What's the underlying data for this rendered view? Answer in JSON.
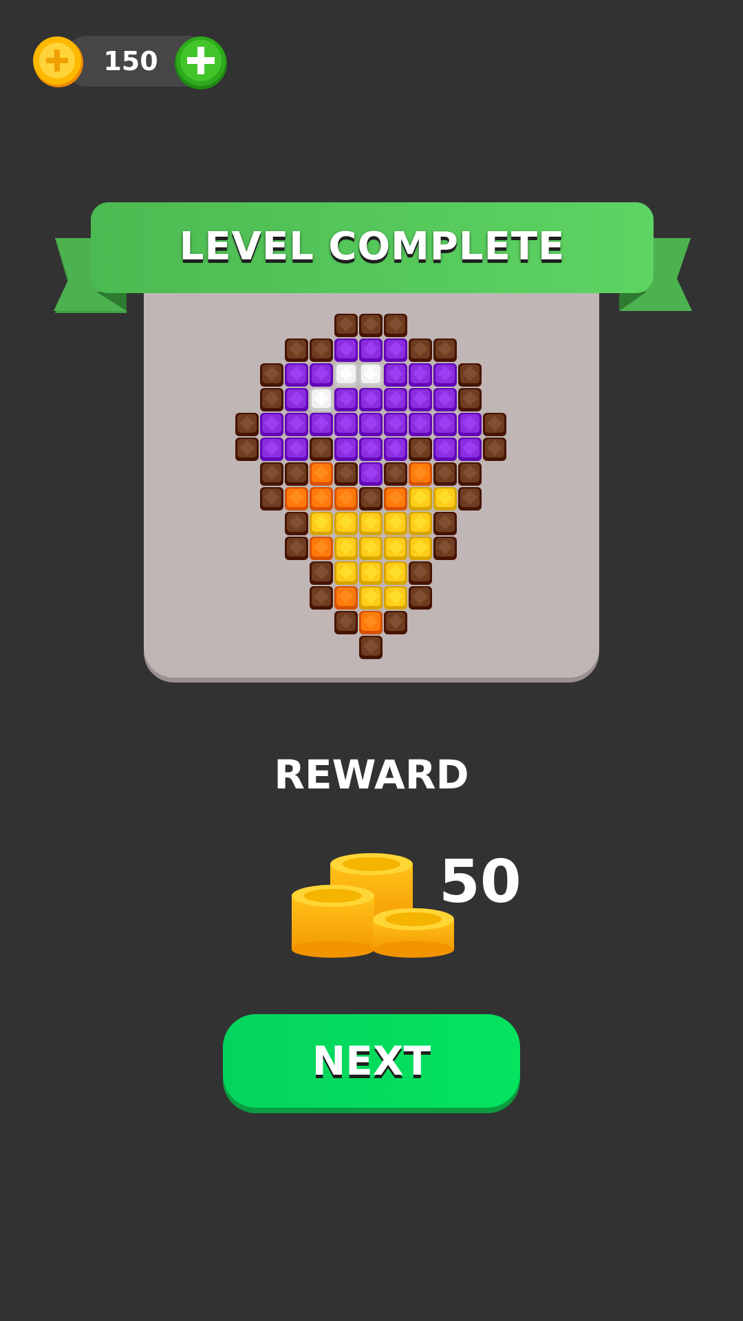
{
  "hud": {
    "coins": "150",
    "coin_icon": "coin-icon",
    "add_icon": "plus-icon"
  },
  "banner": {
    "title": "LEVEL COMPLETE"
  },
  "puzzle": {
    "colors": {
      "B": "#6e3c20",
      "P": "#8a2ee0",
      "W": "#f2f2f2",
      "O": "#ff7a0a",
      "Y": "#ffcc1a"
    },
    "rows": [
      "....BBB....",
      "..BBPPPBB..",
      ".BPPWWPPPB.",
      ".BPWPPPPPB.",
      "BPPPPPPPPPB",
      "BPPBPPPBPPB",
      ".BBOBPBOBB.",
      ".BOOOBOYYB.",
      "..BYYYYYB..",
      "..BOYYYYB..",
      "...BYYYB...",
      "...BOYYB...",
      "....BOB....",
      ".....B....."
    ]
  },
  "reward": {
    "label": "REWARD",
    "amount": "50",
    "icon": "coin-stack-icon"
  },
  "next_button": {
    "label": "NEXT"
  }
}
